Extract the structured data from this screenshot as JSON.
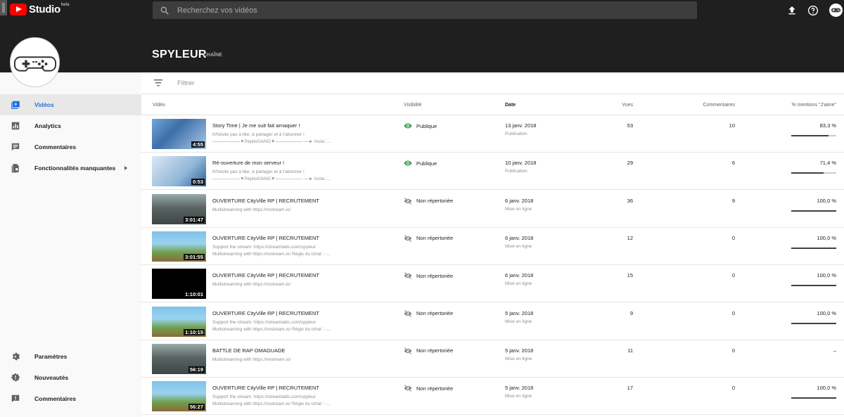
{
  "app": {
    "brand": "Studio",
    "badge": "beta",
    "search_placeholder": "Recherchez vos vidéos"
  },
  "channel": {
    "name": "SPYLEUR",
    "tag": "CHAÎNE"
  },
  "sidebar": {
    "items": [
      {
        "label": "Vidéos",
        "icon": "videos-icon",
        "active": true
      },
      {
        "label": "Analytics",
        "icon": "analytics-icon"
      },
      {
        "label": "Commentaires",
        "icon": "comments-icon"
      },
      {
        "label": "Fonctionnalités manquantes",
        "icon": "missing-features-icon"
      }
    ],
    "bottom_items": [
      {
        "label": "Paramètres",
        "icon": "gear-icon"
      },
      {
        "label": "Nouveautés",
        "icon": "whats-new-icon"
      },
      {
        "label": "Commentaires",
        "icon": "feedback-icon"
      }
    ]
  },
  "filter": {
    "placeholder": "Filtrer"
  },
  "table": {
    "headers": {
      "video": "Vidéo",
      "visibility": "Visibilité",
      "date": "Date",
      "views": "Vues",
      "comments": "Commentaires",
      "likes": "% mentions \"J'aime\""
    },
    "rows": [
      {
        "title": "Story Time | Je me suit fait arnaquer !",
        "desc1": "N'hésite pas à like; à partager et à t'abonner !",
        "desc2": "——————▼PepitoGANG▼—————— —► Insta :...",
        "duration": "4:55",
        "visibility": "Publique",
        "public": true,
        "date": "13 janv. 2018",
        "date_sub": "Publication",
        "views": "53",
        "comments": "10",
        "likes": "83,3 %",
        "like_ratio": 0.833,
        "thumb": "person"
      },
      {
        "title": "Ré-ouverture de mon serveur !",
        "desc1": "N'hésite pas à like; à partager et à t'abonner !",
        "desc2": "——————▼PepitoGANG▼—————— —► Insta :...",
        "duration": "0:53",
        "visibility": "Publique",
        "public": true,
        "date": "10 janv. 2018",
        "date_sub": "Publication",
        "views": "29",
        "comments": "6",
        "likes": "71,4 %",
        "like_ratio": 0.714,
        "thumb": "person2"
      },
      {
        "title": "OUVERTURE CityVille RP | RECRUTEMENT",
        "desc1": "Multistreaming with https://restream.io/",
        "desc2": "",
        "duration": "3:01:47",
        "visibility": "Non répertoriée",
        "public": false,
        "date": "6 janv. 2018",
        "date_sub": "Mise en ligne",
        "views": "36",
        "comments": "9",
        "likes": "100,0 %",
        "like_ratio": 1.0,
        "thumb": "room"
      },
      {
        "title": "OUVERTURE CityVille RP | RECRUTEMENT",
        "desc1": "Support the stream: https://streamlabs.com/spyleur",
        "desc2": "Multistreaming with https://restream.io/ Règle du tchat : -...",
        "duration": "3:01:55",
        "visibility": "Non répertoriée",
        "public": false,
        "date": "6 janv. 2018",
        "date_sub": "Mise en ligne",
        "views": "12",
        "comments": "0",
        "likes": "100,0 %",
        "like_ratio": 1.0,
        "thumb": "city"
      },
      {
        "title": "OUVERTURE CityVille RP | RECRUTEMENT",
        "desc1": "Multistreaming with https://restream.io/",
        "desc2": "",
        "duration": "1:10:01",
        "visibility": "Non répertoriée",
        "public": false,
        "date": "6 janv. 2018",
        "date_sub": "Mise en ligne",
        "views": "15",
        "comments": "0",
        "likes": "100,0 %",
        "like_ratio": 1.0,
        "thumb": "black"
      },
      {
        "title": "OUVERTURE CityVille RP | RECRUTEMENT",
        "desc1": "Support the stream: https://streamlabs.com/spyleur",
        "desc2": "Multistreaming with https://restream.io/ Règle du tchat : -...",
        "duration": "1:10:15",
        "visibility": "Non répertoriée",
        "public": false,
        "date": "5 janv. 2018",
        "date_sub": "Mise en ligne",
        "views": "9",
        "comments": "0",
        "likes": "100,0 %",
        "like_ratio": 1.0,
        "thumb": "city"
      },
      {
        "title": "BATTLE DE RAP OMAGUADE",
        "desc1": "Multistreaming with https://restream.io/",
        "desc2": "",
        "duration": "56:19",
        "visibility": "Non répertoriée",
        "public": false,
        "date": "5 janv. 2018",
        "date_sub": "Mise en ligne",
        "views": "11",
        "comments": "0",
        "likes": "–",
        "like_ratio": null,
        "thumb": "room"
      },
      {
        "title": "OUVERTURE CityVille RP | RECRUTEMENT",
        "desc1": "Support the stream: https://streamlabs.com/spyleur",
        "desc2": "Multistreaming with https://restream.io/ Règle du tchat : -...",
        "duration": "56:27",
        "visibility": "Non répertoriée",
        "public": false,
        "date": "5 janv. 2018",
        "date_sub": "Mise en ligne",
        "views": "17",
        "comments": "0",
        "likes": "100,0 %",
        "like_ratio": 1.0,
        "thumb": "city"
      }
    ]
  },
  "colors": {
    "topbar": "#1f1f1f",
    "accent": "#1a73e8",
    "public_green": "#2e9e44",
    "brand_red": "#ff0000"
  }
}
